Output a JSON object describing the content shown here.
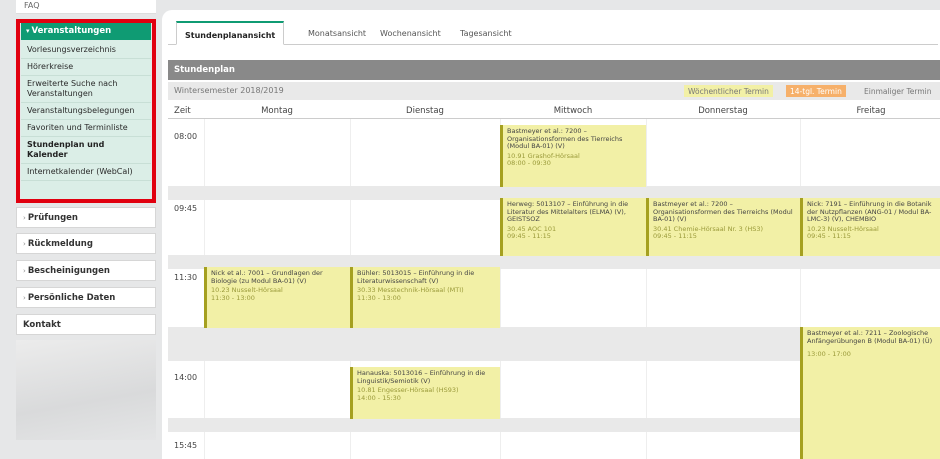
{
  "sidebar": {
    "faq": "FAQ",
    "section_title": "Veranstaltungen",
    "items": [
      {
        "label": "Vorlesungsverzeichnis",
        "bold": false
      },
      {
        "label": "Hörerkreise",
        "bold": false
      },
      {
        "label": "Erweiterte Suche nach Veranstaltungen",
        "bold": false
      },
      {
        "label": "Veranstaltungsbelegungen",
        "bold": false
      },
      {
        "label": "Favoriten und Terminliste",
        "bold": false
      },
      {
        "label": "Stundenplan und Kalender",
        "bold": true
      },
      {
        "label": "Internetkalender (WebCal)",
        "bold": false
      }
    ],
    "closed_sections": [
      "Prüfungen",
      "Rückmeldung",
      "Bescheinigungen",
      "Persönliche Daten",
      "Kontakt"
    ],
    "highlight_color": "#e1000f",
    "accent_color": "#0f9b73"
  },
  "tabs": [
    "Stundenplanansicht",
    "Monatsansicht",
    "Wochenansicht",
    "Tagesansicht"
  ],
  "active_tab": "Stundenplanansicht",
  "schedule": {
    "header": "Stundenplan",
    "semester": "Wintersemester 2018/2019",
    "legend": [
      "Wöchentlicher Termin",
      "14-tgl. Termin",
      "Einmaliger Termin"
    ],
    "columns": [
      "Zeit",
      "Montag",
      "Dienstag",
      "Mittwoch",
      "Donnerstag",
      "Freitag"
    ],
    "times": [
      "08:00",
      "09:45",
      "11:30",
      "14:00",
      "15:45"
    ],
    "events": [
      {
        "id": "wed-0800",
        "title": "Bastmeyer et al.: 7200 – Organisationsformen des Tierreichs (Modul BA-01) (V)",
        "room": "10.91 Grashof-Hörsaal",
        "time": "08:00 - 09:30"
      },
      {
        "id": "wed-0945",
        "title": "Herweg: 5013107 – Einführung in die Literatur des Mittelalters (ELMA) (V), GEISTSOZ",
        "room": "30.45 AOC 101",
        "time": "09:45 - 11:15"
      },
      {
        "id": "thu-0945",
        "title": "Bastmeyer et al.: 7200 – Organisationsformen des Tierreichs (Modul BA-01) (V)",
        "room": "30.41 Chemie-Hörsaal Nr. 3 (HS3)",
        "time": "09:45 - 11:15"
      },
      {
        "id": "fri-0945",
        "title": "Nick: 7191 – Einführung in die Botanik der Nutzpflanzen (ANG-01 / Modul BA-LMC-3) (V), CHEMBIO",
        "room": "10.23 Nusselt-Hörsaal",
        "time": "09:45 - 11:15"
      },
      {
        "id": "mon-1130",
        "title": "Nick et al.: 7001 – Grundlagen der Biologie (zu Modul BA-01) (V)",
        "room": "10.23 Nusselt-Hörsaal",
        "time": "11:30 - 13:00"
      },
      {
        "id": "tue-1130",
        "title": "Bühler: 5013015 – Einführung in die Literaturwissenschaft (V)",
        "room": "30.33 Messtechnik-Hörsaal (MTI)",
        "time": "11:30 - 13:00"
      },
      {
        "id": "fri-1300",
        "title": "Bastmeyer et al.: 7211 – Zoologische Anfängerübungen B (Modul BA-01) (Ü)",
        "room": "",
        "time": "13:00 - 17:00"
      },
      {
        "id": "tue-1400",
        "title": "Hanauska: 5013016 – Einführung in die Linguistik/Semiotik (V)",
        "room": "10.81 Engesser-Hörsaal (HS93)",
        "time": "14:00 - 15:30"
      }
    ]
  }
}
